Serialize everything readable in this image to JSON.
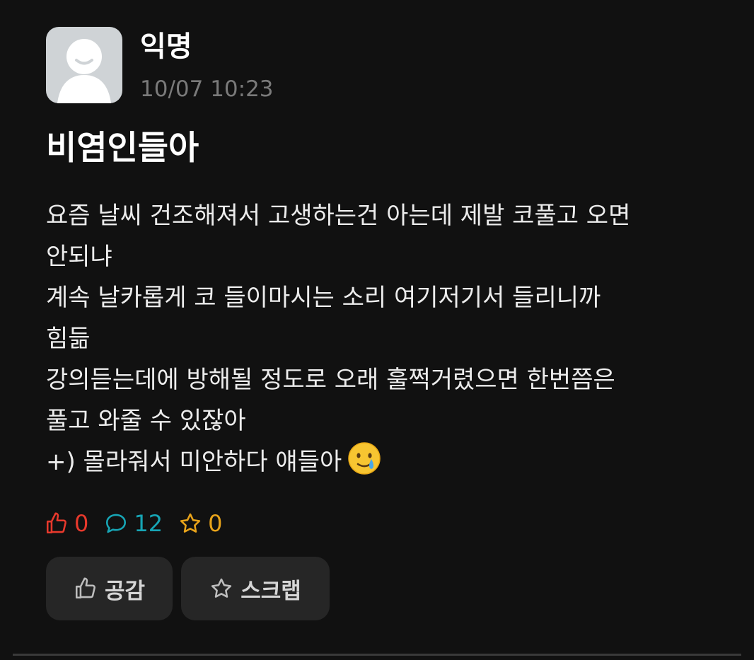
{
  "author": {
    "name": "익명",
    "time": "10/07 10:23"
  },
  "post": {
    "title": "비염인들아",
    "lines": [
      "요즘 날씨 건조해져서 고생하는건 아는데 제발 코풀고 오면",
      "안되냐",
      "계속 날카롭게 코 들이마시는 소리 여기저기서 들리니까",
      "힘듦",
      "강의듣는데에 방해될 정도로 오래 훌쩍거렸으면 한번쯤은",
      "풀고 와줄 수 있잖아",
      "+) 몰라줘서 미안하다 얘들아"
    ],
    "emoji": "smiling-face-with-tear"
  },
  "stats": {
    "likes": "0",
    "comments": "12",
    "scraps": "0"
  },
  "actions": {
    "like_label": "공감",
    "scrap_label": "스크랩"
  },
  "colors": {
    "like": "#e8392c",
    "comment": "#17a5b5",
    "scrap": "#e8a31a",
    "background": "#111111",
    "button": "#262626"
  }
}
